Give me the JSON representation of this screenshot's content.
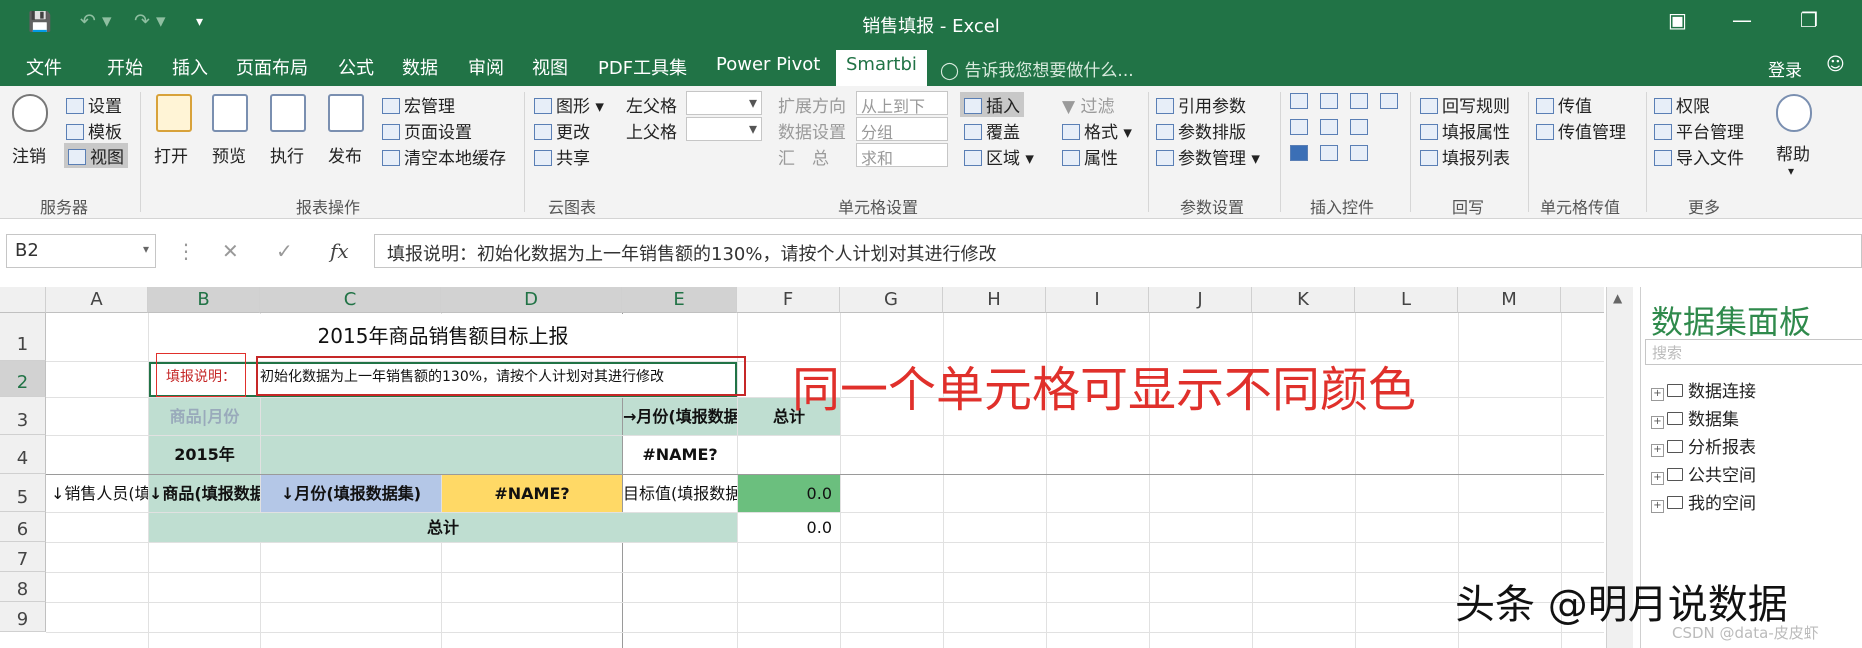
{
  "title_bar": {
    "title": "销售填报 - Excel"
  },
  "menu_tabs": [
    "文件",
    "开始",
    "插入",
    "页面布局",
    "公式",
    "数据",
    "审阅",
    "视图",
    "PDF工具集",
    "Power Pivot",
    "Smartbi"
  ],
  "tell_me": "告诉我您想要做什么...",
  "login": "登录",
  "ribbon": {
    "server": {
      "settings": "设置",
      "template": "模板",
      "view": "视图",
      "logout": "注销",
      "group": "服务器"
    },
    "report_ops": {
      "open": "打开",
      "preview": "预览",
      "execute": "执行",
      "publish": "发布",
      "macro": "宏管理",
      "page_setup": "页面设置",
      "clear_cache": "清空本地缓存",
      "group": "报表操作"
    },
    "cloud": {
      "chart": "图形",
      "change": "更改",
      "share": "共享",
      "group": "云图表"
    },
    "cell_settings": {
      "left_parent": "左父格",
      "top_parent": "上父格",
      "expand_dir": "扩展方向",
      "expand_val": "从上到下",
      "data_set": "数据设置",
      "data_val": "分组",
      "summary": "汇　总",
      "summary_val": "求和",
      "insert": "插入",
      "cover": "覆盖",
      "area": "区域",
      "filter": "过滤",
      "format": "格式",
      "property": "属性",
      "group": "单元格设置"
    },
    "params": {
      "ref": "引用参数",
      "layout": "参数排版",
      "manage": "参数管理",
      "group": "参数设置"
    },
    "controls": {
      "group": "插入控件"
    },
    "writeback": {
      "rules": "回写规则",
      "fill_attr": "填报属性",
      "fill_list": "填报列表",
      "group": "回写"
    },
    "transfer": {
      "pass": "传值",
      "pass_mgmt": "传值管理",
      "group": "单元格传值"
    },
    "more": {
      "perm": "权限",
      "platform": "平台管理",
      "import": "导入文件",
      "help": "帮助",
      "group": "更多"
    }
  },
  "formula_bar": {
    "name_box": "B2",
    "fx": "fx",
    "content": "填报说明：初始化数据为上一年销售额的130%，请按个人计划对其进行修改"
  },
  "columns": [
    "A",
    "B",
    "C",
    "D",
    "E",
    "F",
    "G",
    "H",
    "I",
    "J",
    "K",
    "L",
    "M"
  ],
  "rows": [
    "1",
    "2",
    "3",
    "4",
    "5",
    "6",
    "7",
    "8",
    "9"
  ],
  "sheet": {
    "title": "2015年商品销售额目标上报",
    "note_label": "填报说明：",
    "note_text": "初始化数据为上一年销售额的130%，请按个人计划对其进行修改",
    "b3": "商品|月份",
    "e3": "→月份(填报数据集)",
    "f3": "总计",
    "b4": "2015年",
    "e4": "#NAME?",
    "a5": "↓销售人员(填报数据集)",
    "b5": "↓商品(填报数据集)",
    "c5": "↓月份(填报数据集)",
    "d5": "#NAME?",
    "e5": "目标值(填报数据集)",
    "f5": "0.0",
    "b6": "总计",
    "f6": "0.0"
  },
  "annotation": "同一个单元格可显示不同颜色",
  "panel": {
    "title": "数据集面板",
    "search": "搜索",
    "items": [
      "数据连接",
      "数据集",
      "分析报表",
      "公共空间",
      "我的空间"
    ]
  },
  "watermark": "头条 @明月说数据",
  "watermark2": "CSDN @data-皮皮虾"
}
